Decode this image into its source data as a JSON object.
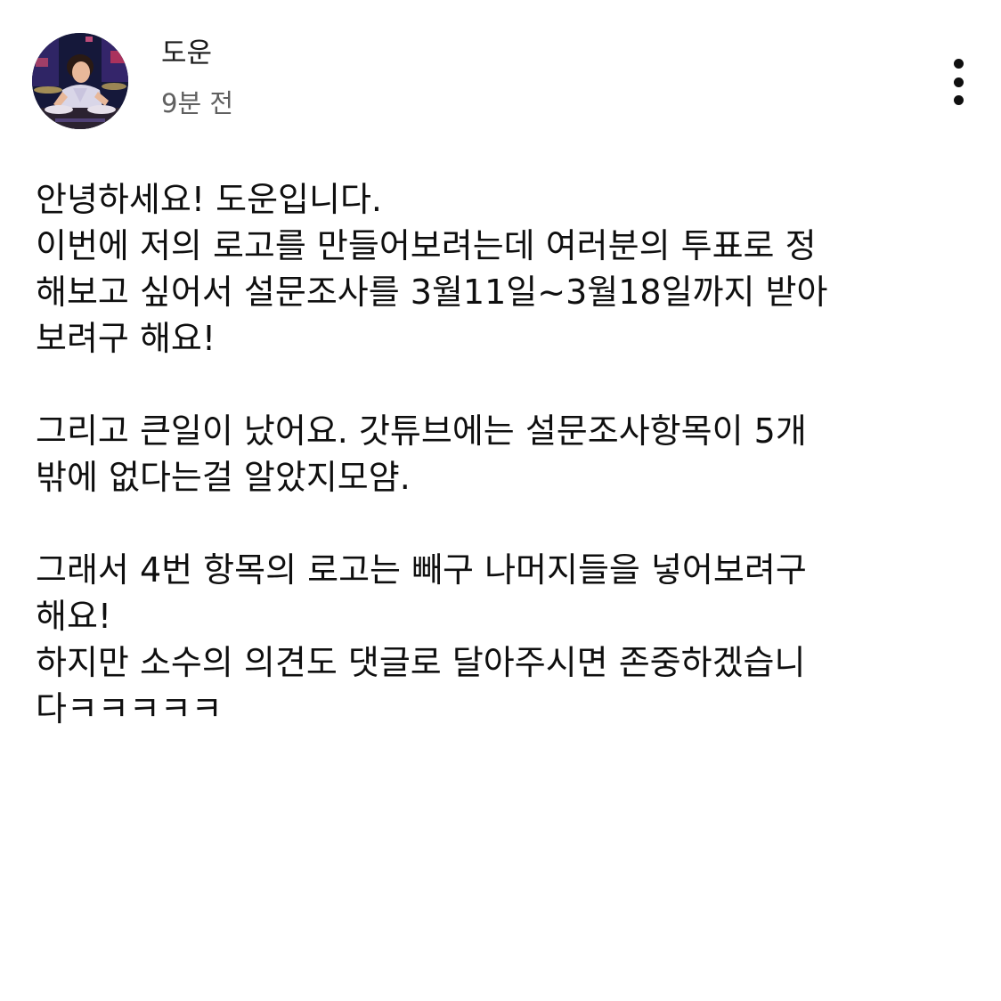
{
  "post": {
    "author": {
      "name": "도운",
      "avatar_icon": "profile-photo"
    },
    "timestamp": "9분 전",
    "menu_icon": "more-vert-icon",
    "body_lines": [
      "안녕하세요! 도운입니다.",
      "이번에 저의 로고를 만들어보려는데 여러분의 투표로 정",
      "해보고 싶어서 설문조사를 3월11일~3월18일까지 받아",
      "보려구 해요!",
      "",
      "그리고 큰일이 났어요. 갓튜브에는 설문조사항목이 5개",
      "밖에 없다는걸 알았지모얌.",
      "",
      "그래서 4번 항목의 로고는 빼구 나머지들을 넣어보려구",
      "해요!",
      "하지만 소수의 의견도 댓글로 달아주시면 존중하겠습니",
      "다ㅋㅋㅋㅋㅋ"
    ]
  },
  "colors": {
    "text": "#0f0f0f",
    "secondary_text": "#606060",
    "background": "#ffffff"
  }
}
